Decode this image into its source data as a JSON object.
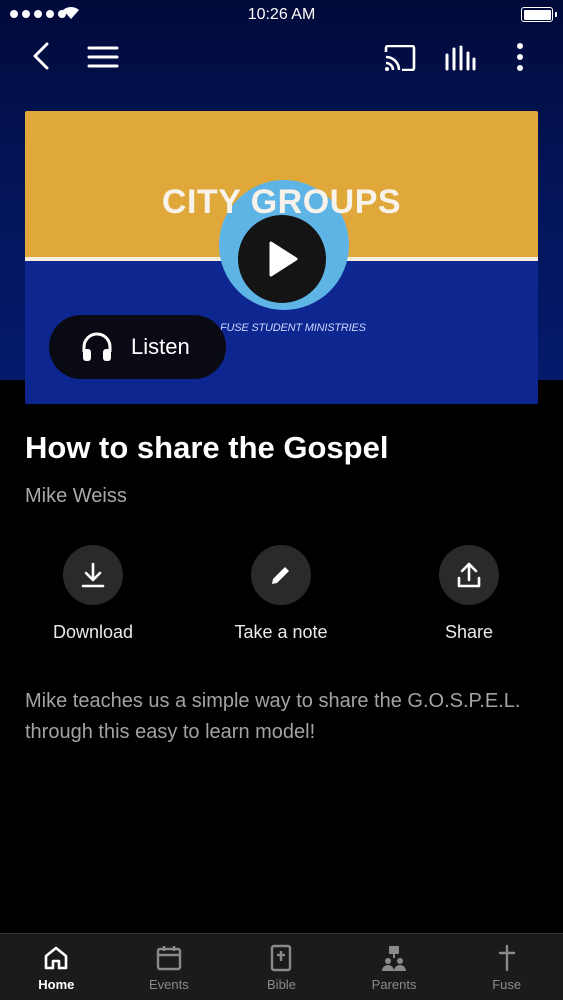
{
  "status_bar": {
    "time": "10:26 AM"
  },
  "media": {
    "thumbnail_title": "CITY GROUPS",
    "thumbnail_subtitle": "FUSE STUDENT MINISTRIES",
    "listen_label": "Listen",
    "colors": {
      "top": "#e0a83a",
      "bottom": "#0d2690",
      "ring": "#5fb4e6"
    }
  },
  "content": {
    "title": "How to share the Gospel",
    "author": "Mike Weiss",
    "description": "Mike teaches us a simple way to share the G.O.S.P.E.L. through this easy to learn model!"
  },
  "actions": [
    {
      "label": "Download",
      "icon": "download-icon"
    },
    {
      "label": "Take a note",
      "icon": "pencil-icon"
    },
    {
      "label": "Share",
      "icon": "share-icon"
    }
  ],
  "tabs": [
    {
      "label": "Home",
      "icon": "home-icon",
      "active": true
    },
    {
      "label": "Events",
      "icon": "calendar-icon",
      "active": false
    },
    {
      "label": "Bible",
      "icon": "bible-icon",
      "active": false
    },
    {
      "label": "Parents",
      "icon": "parents-icon",
      "active": false
    },
    {
      "label": "Fuse",
      "icon": "cross-icon",
      "active": false
    }
  ]
}
